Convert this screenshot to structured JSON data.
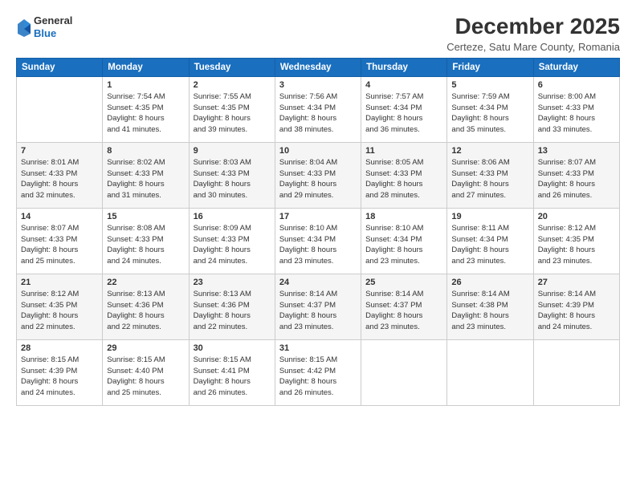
{
  "header": {
    "logo_line1": "General",
    "logo_line2": "Blue",
    "month": "December 2025",
    "location": "Certeze, Satu Mare County, Romania"
  },
  "weekdays": [
    "Sunday",
    "Monday",
    "Tuesday",
    "Wednesday",
    "Thursday",
    "Friday",
    "Saturday"
  ],
  "weeks": [
    [
      {
        "day": "",
        "info": ""
      },
      {
        "day": "1",
        "info": "Sunrise: 7:54 AM\nSunset: 4:35 PM\nDaylight: 8 hours\nand 41 minutes."
      },
      {
        "day": "2",
        "info": "Sunrise: 7:55 AM\nSunset: 4:35 PM\nDaylight: 8 hours\nand 39 minutes."
      },
      {
        "day": "3",
        "info": "Sunrise: 7:56 AM\nSunset: 4:34 PM\nDaylight: 8 hours\nand 38 minutes."
      },
      {
        "day": "4",
        "info": "Sunrise: 7:57 AM\nSunset: 4:34 PM\nDaylight: 8 hours\nand 36 minutes."
      },
      {
        "day": "5",
        "info": "Sunrise: 7:59 AM\nSunset: 4:34 PM\nDaylight: 8 hours\nand 35 minutes."
      },
      {
        "day": "6",
        "info": "Sunrise: 8:00 AM\nSunset: 4:33 PM\nDaylight: 8 hours\nand 33 minutes."
      }
    ],
    [
      {
        "day": "7",
        "info": "Sunrise: 8:01 AM\nSunset: 4:33 PM\nDaylight: 8 hours\nand 32 minutes."
      },
      {
        "day": "8",
        "info": "Sunrise: 8:02 AM\nSunset: 4:33 PM\nDaylight: 8 hours\nand 31 minutes."
      },
      {
        "day": "9",
        "info": "Sunrise: 8:03 AM\nSunset: 4:33 PM\nDaylight: 8 hours\nand 30 minutes."
      },
      {
        "day": "10",
        "info": "Sunrise: 8:04 AM\nSunset: 4:33 PM\nDaylight: 8 hours\nand 29 minutes."
      },
      {
        "day": "11",
        "info": "Sunrise: 8:05 AM\nSunset: 4:33 PM\nDaylight: 8 hours\nand 28 minutes."
      },
      {
        "day": "12",
        "info": "Sunrise: 8:06 AM\nSunset: 4:33 PM\nDaylight: 8 hours\nand 27 minutes."
      },
      {
        "day": "13",
        "info": "Sunrise: 8:07 AM\nSunset: 4:33 PM\nDaylight: 8 hours\nand 26 minutes."
      }
    ],
    [
      {
        "day": "14",
        "info": "Sunrise: 8:07 AM\nSunset: 4:33 PM\nDaylight: 8 hours\nand 25 minutes."
      },
      {
        "day": "15",
        "info": "Sunrise: 8:08 AM\nSunset: 4:33 PM\nDaylight: 8 hours\nand 24 minutes."
      },
      {
        "day": "16",
        "info": "Sunrise: 8:09 AM\nSunset: 4:33 PM\nDaylight: 8 hours\nand 24 minutes."
      },
      {
        "day": "17",
        "info": "Sunrise: 8:10 AM\nSunset: 4:34 PM\nDaylight: 8 hours\nand 23 minutes."
      },
      {
        "day": "18",
        "info": "Sunrise: 8:10 AM\nSunset: 4:34 PM\nDaylight: 8 hours\nand 23 minutes."
      },
      {
        "day": "19",
        "info": "Sunrise: 8:11 AM\nSunset: 4:34 PM\nDaylight: 8 hours\nand 23 minutes."
      },
      {
        "day": "20",
        "info": "Sunrise: 8:12 AM\nSunset: 4:35 PM\nDaylight: 8 hours\nand 23 minutes."
      }
    ],
    [
      {
        "day": "21",
        "info": "Sunrise: 8:12 AM\nSunset: 4:35 PM\nDaylight: 8 hours\nand 22 minutes."
      },
      {
        "day": "22",
        "info": "Sunrise: 8:13 AM\nSunset: 4:36 PM\nDaylight: 8 hours\nand 22 minutes."
      },
      {
        "day": "23",
        "info": "Sunrise: 8:13 AM\nSunset: 4:36 PM\nDaylight: 8 hours\nand 22 minutes."
      },
      {
        "day": "24",
        "info": "Sunrise: 8:14 AM\nSunset: 4:37 PM\nDaylight: 8 hours\nand 23 minutes."
      },
      {
        "day": "25",
        "info": "Sunrise: 8:14 AM\nSunset: 4:37 PM\nDaylight: 8 hours\nand 23 minutes."
      },
      {
        "day": "26",
        "info": "Sunrise: 8:14 AM\nSunset: 4:38 PM\nDaylight: 8 hours\nand 23 minutes."
      },
      {
        "day": "27",
        "info": "Sunrise: 8:14 AM\nSunset: 4:39 PM\nDaylight: 8 hours\nand 24 minutes."
      }
    ],
    [
      {
        "day": "28",
        "info": "Sunrise: 8:15 AM\nSunset: 4:39 PM\nDaylight: 8 hours\nand 24 minutes."
      },
      {
        "day": "29",
        "info": "Sunrise: 8:15 AM\nSunset: 4:40 PM\nDaylight: 8 hours\nand 25 minutes."
      },
      {
        "day": "30",
        "info": "Sunrise: 8:15 AM\nSunset: 4:41 PM\nDaylight: 8 hours\nand 26 minutes."
      },
      {
        "day": "31",
        "info": "Sunrise: 8:15 AM\nSunset: 4:42 PM\nDaylight: 8 hours\nand 26 minutes."
      },
      {
        "day": "",
        "info": ""
      },
      {
        "day": "",
        "info": ""
      },
      {
        "day": "",
        "info": ""
      }
    ]
  ]
}
